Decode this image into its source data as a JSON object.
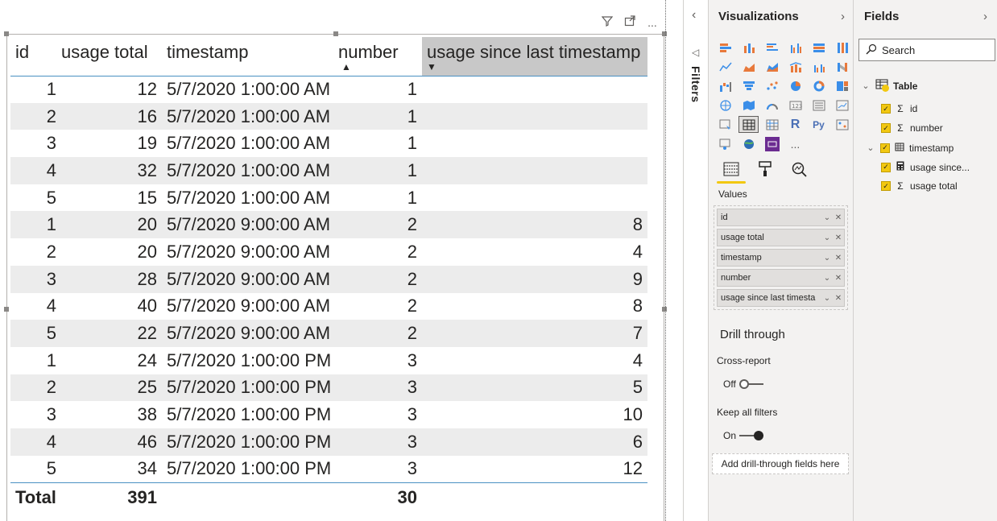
{
  "table": {
    "columns": [
      "id",
      "usage total",
      "timestamp",
      "number",
      "usage since last timestamp"
    ],
    "rows": [
      [
        "1",
        "12",
        "5/7/2020 1:00:00 AM",
        "1",
        ""
      ],
      [
        "2",
        "16",
        "5/7/2020 1:00:00 AM",
        "1",
        ""
      ],
      [
        "3",
        "19",
        "5/7/2020 1:00:00 AM",
        "1",
        ""
      ],
      [
        "4",
        "32",
        "5/7/2020 1:00:00 AM",
        "1",
        ""
      ],
      [
        "5",
        "15",
        "5/7/2020 1:00:00 AM",
        "1",
        ""
      ],
      [
        "1",
        "20",
        "5/7/2020 9:00:00 AM",
        "2",
        "8"
      ],
      [
        "2",
        "20",
        "5/7/2020 9:00:00 AM",
        "2",
        "4"
      ],
      [
        "3",
        "28",
        "5/7/2020 9:00:00 AM",
        "2",
        "9"
      ],
      [
        "4",
        "40",
        "5/7/2020 9:00:00 AM",
        "2",
        "8"
      ],
      [
        "5",
        "22",
        "5/7/2020 9:00:00 AM",
        "2",
        "7"
      ],
      [
        "1",
        "24",
        "5/7/2020 1:00:00 PM",
        "3",
        "4"
      ],
      [
        "2",
        "25",
        "5/7/2020 1:00:00 PM",
        "3",
        "5"
      ],
      [
        "3",
        "38",
        "5/7/2020 1:00:00 PM",
        "3",
        "10"
      ],
      [
        "4",
        "46",
        "5/7/2020 1:00:00 PM",
        "3",
        "6"
      ],
      [
        "5",
        "34",
        "5/7/2020 1:00:00 PM",
        "3",
        "12"
      ]
    ],
    "total": {
      "label": "Total",
      "usage_total": "391",
      "number": "30"
    }
  },
  "filters": {
    "label": "Filters"
  },
  "visualizations": {
    "title": "Visualizations",
    "values_label": "Values",
    "wells": [
      "id",
      "usage total",
      "timestamp",
      "number",
      "usage since last timesta"
    ],
    "drill_through": {
      "title": "Drill through",
      "cross_report": {
        "label": "Cross-report",
        "state": "Off"
      },
      "keep_all_filters": {
        "label": "Keep all filters",
        "state": "On"
      },
      "drop_text": "Add drill-through fields here"
    },
    "more": "..."
  },
  "fields": {
    "title": "Fields",
    "search_placeholder": "Search",
    "table_name": "Table",
    "items": [
      {
        "label": "id",
        "icon": "sigma-icon"
      },
      {
        "label": "number",
        "icon": "sigma-icon"
      },
      {
        "label": "timestamp",
        "icon": "calendar-icon"
      },
      {
        "label": "usage since...",
        "icon": "calculator-icon"
      },
      {
        "label": "usage total",
        "icon": "sigma-icon"
      }
    ]
  },
  "colors": {
    "accent": "#f2c811",
    "header_highlight": "#c8c8c8",
    "row_alt": "#ececec",
    "rule": "#4a90c2"
  }
}
